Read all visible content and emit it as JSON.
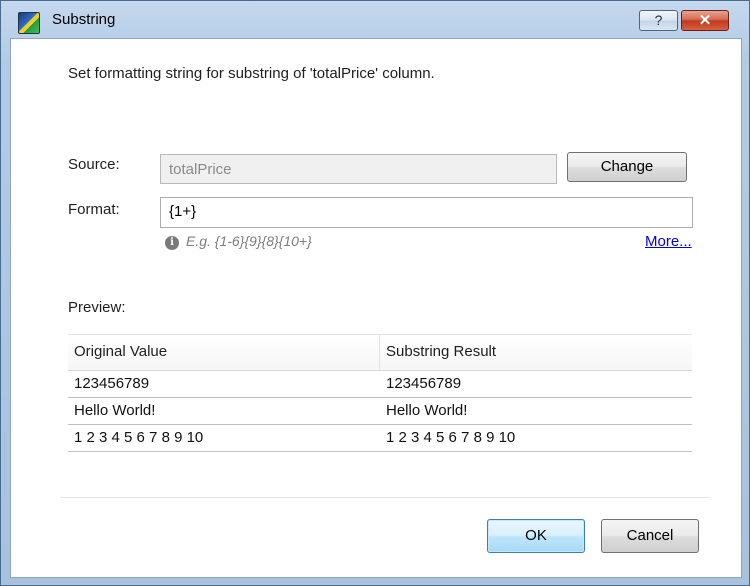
{
  "window": {
    "title": "Substring",
    "help_label": "?",
    "close_label": "✕"
  },
  "dialog": {
    "instructions": "Set formatting string for substring of 'totalPrice' column.",
    "source": {
      "label": "Source:",
      "value": "totalPrice",
      "change_label": "Change"
    },
    "format": {
      "label": "Format:",
      "value": "{1+}",
      "example": "E.g. {1-6}{9}{8}{10+}",
      "info_glyph": "i",
      "more_label": "More..."
    },
    "preview": {
      "label": "Preview:",
      "columns": [
        "Original Value",
        "Substring Result"
      ],
      "rows": [
        [
          "123456789",
          "123456789"
        ],
        [
          "Hello World!",
          "Hello World!"
        ],
        [
          "1 2 3 4 5 6 7 8 9 10",
          "1 2 3 4 5 6 7 8 9 10"
        ]
      ]
    },
    "ok_label": "OK",
    "cancel_label": "Cancel"
  }
}
